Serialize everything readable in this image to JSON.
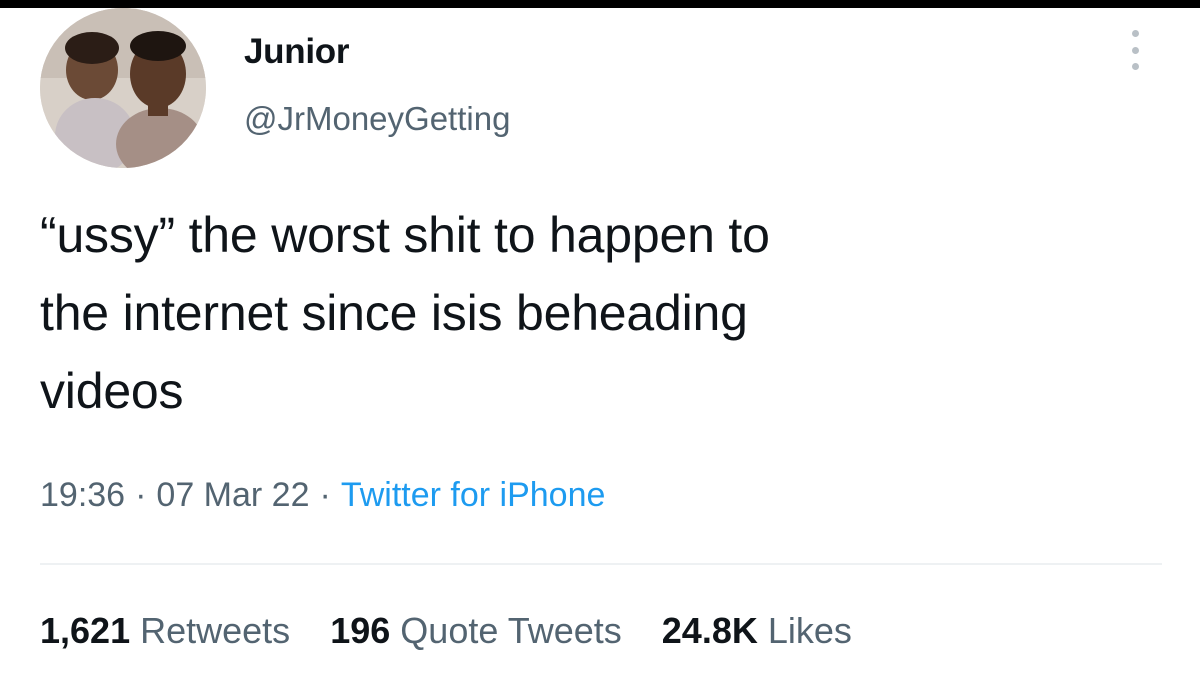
{
  "colors": {
    "text_primary": "#0f1419",
    "text_secondary": "#536471",
    "link": "#1d9bf0",
    "divider": "#eef1f3"
  },
  "author": {
    "display_name": "Junior",
    "handle": "@JrMoneyGetting",
    "avatar_icon": "profile-photo"
  },
  "tweet": {
    "text": "“ussy” the worst shit to happen to\nthe internet since isis beheading\nvideos",
    "time": "19:36",
    "date": "07 Mar 22",
    "separator": "·",
    "source": "Twitter for iPhone"
  },
  "stats": {
    "retweets": {
      "count": "1,621",
      "label": "Retweets"
    },
    "quote_tweets": {
      "count": "196",
      "label": "Quote Tweets"
    },
    "likes": {
      "count": "24.8K",
      "label": "Likes"
    }
  },
  "menu_icon": "more-options-icon"
}
